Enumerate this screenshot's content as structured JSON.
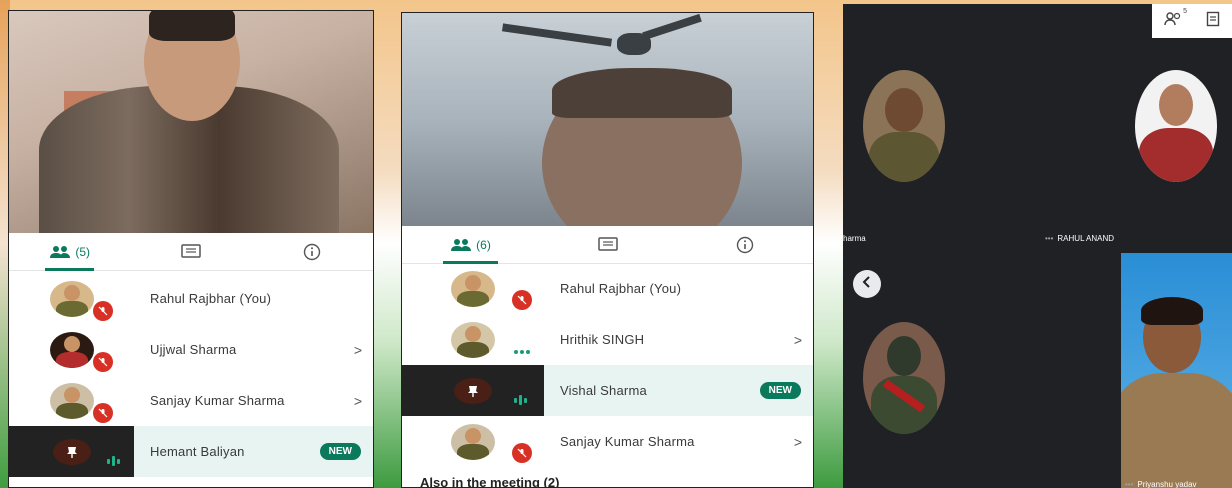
{
  "panel_left": {
    "tabs": [
      {
        "icon": "people-icon",
        "label": "(5)",
        "active": true
      },
      {
        "icon": "chat-icon",
        "label": ""
      },
      {
        "icon": "info-icon",
        "label": ""
      }
    ],
    "participants": [
      {
        "name": "Rahul Rajbhar (You)",
        "status": "muted",
        "chevron": ""
      },
      {
        "name": "Ujjwal Sharma",
        "status": "muted",
        "chevron": ">"
      },
      {
        "name": "Sanjay Kumar Sharma",
        "status": "muted",
        "chevron": ">"
      },
      {
        "name": "Hemant Baliyan",
        "status": "speaking",
        "badge": "NEW",
        "chevron": ""
      }
    ]
  },
  "panel_middle": {
    "tabs": [
      {
        "icon": "people-icon",
        "label": "(6)",
        "active": true
      },
      {
        "icon": "chat-icon",
        "label": ""
      },
      {
        "icon": "info-icon",
        "label": ""
      }
    ],
    "participants": [
      {
        "name": "Rahul Rajbhar (You)",
        "status": "muted",
        "chevron": ""
      },
      {
        "name": "Hrithik SINGH",
        "status": "connecting",
        "chevron": ">"
      },
      {
        "name": "Vishal Sharma",
        "status": "speaking",
        "badge": "NEW",
        "chevron": ""
      },
      {
        "name": "Sanjay Kumar Sharma",
        "status": "muted",
        "chevron": ">"
      }
    ],
    "also_in_meeting": "Also in the meeting (2)"
  },
  "panel_right": {
    "toolbar_icons": [
      "people-icon",
      "chat-icon"
    ],
    "people_count": "5",
    "tiles": [
      {
        "label": "harma"
      },
      {
        "label": "RAHUL ANAND"
      },
      {
        "label": "Priyanshu yadav"
      }
    ],
    "colors": {
      "background": "#202124",
      "accent": "#0b7a5c",
      "mute": "#d93025"
    }
  }
}
